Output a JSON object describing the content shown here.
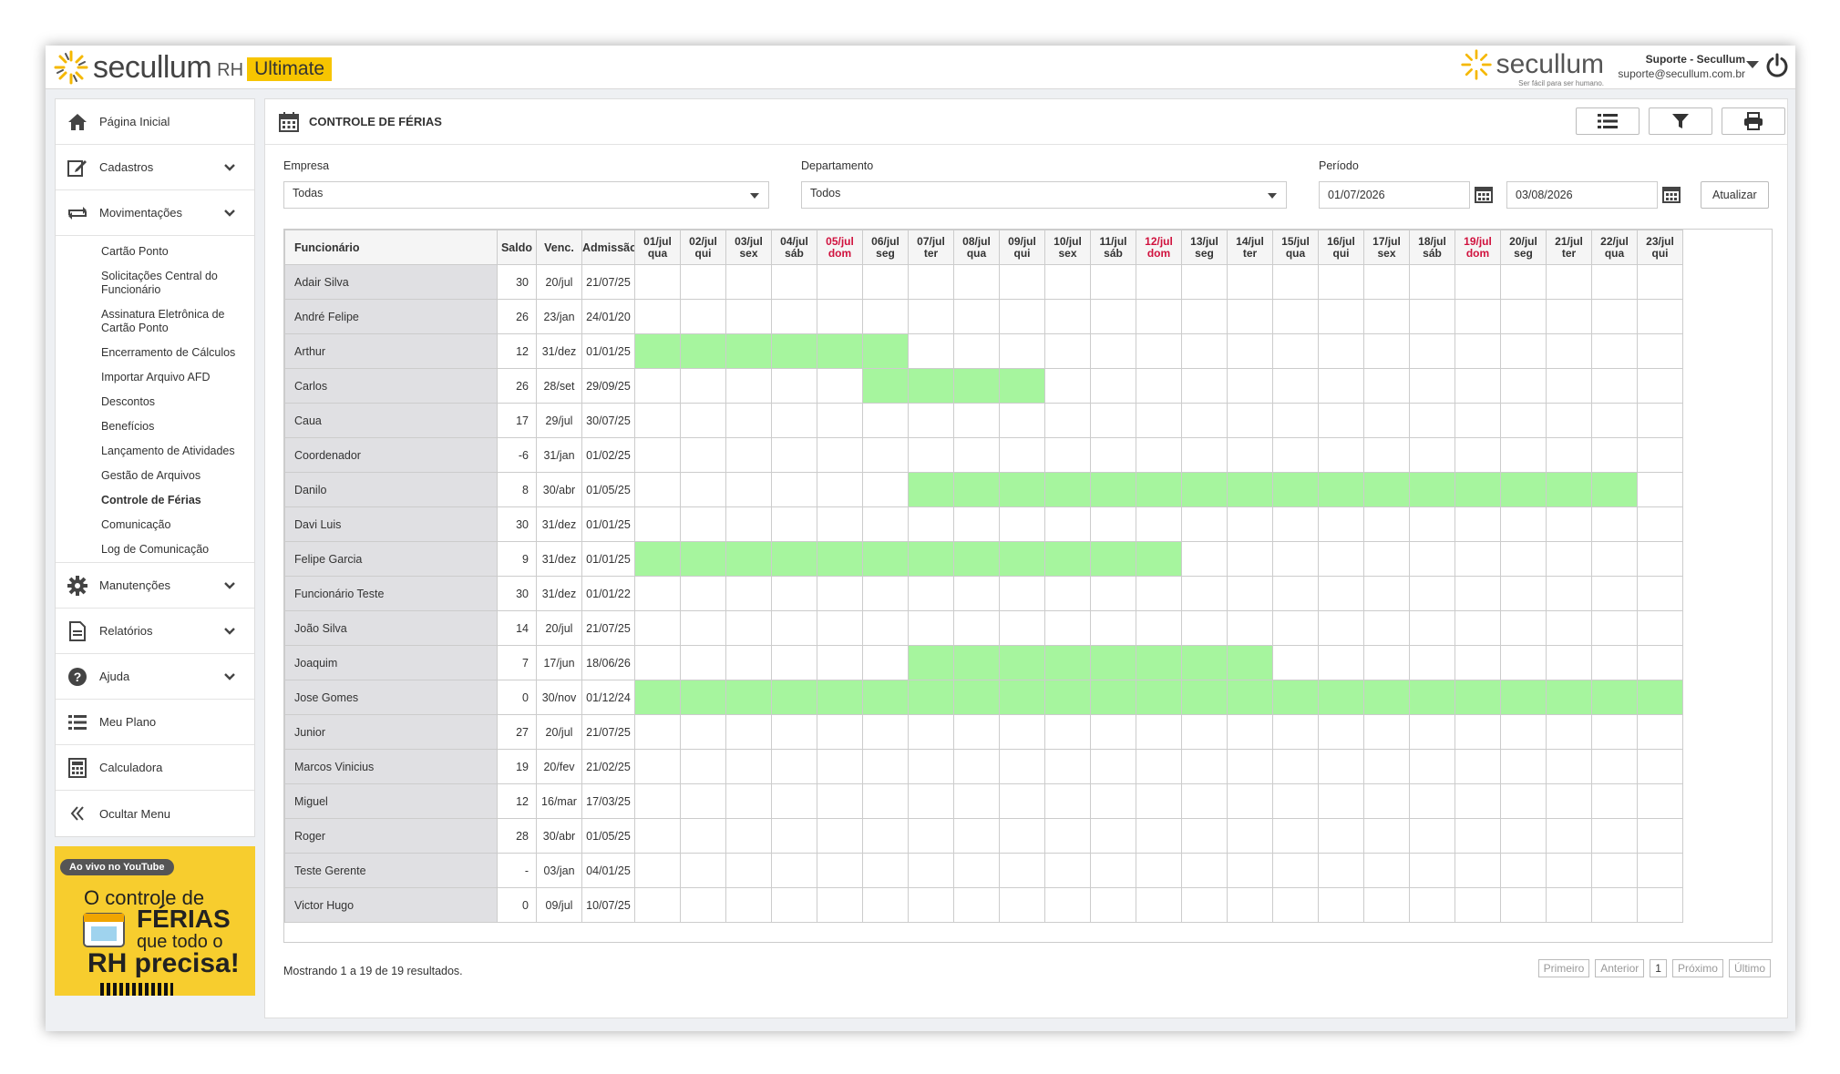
{
  "app": {
    "brand": "secullum",
    "product": "RH",
    "edition": "Ultimate",
    "top_brand": "secullum",
    "top_tagline": "Ser fácil para ser humano.",
    "user_name": "Suporte - Secullum",
    "user_email": "suporte@secullum.com.br"
  },
  "sidebar": {
    "home": "Página Inicial",
    "cadastros": "Cadastros",
    "movimentacoes": "Movimentações",
    "sub_items": [
      "Cartão Ponto",
      "Solicitações Central do Funcionário",
      "Assinatura Eletrônica de Cartão Ponto",
      "Encerramento de Cálculos",
      "Importar Arquivo AFD",
      "Descontos",
      "Benefícios",
      "Lançamento de Atividades",
      "Gestão de Arquivos",
      "Controle de Férias",
      "Comunicação",
      "Log de Comunicação"
    ],
    "active_sub": "Controle de Férias",
    "manutencoes": "Manutenções",
    "relatorios": "Relatórios",
    "ajuda": "Ajuda",
    "meu_plano": "Meu Plano",
    "calculadora": "Calculadora",
    "ocultar": "Ocultar Menu"
  },
  "promo": {
    "badge": "Ao vivo no YouTube",
    "line1": "O controle de",
    "line2": "FÉRIAS",
    "line3": "que todo o",
    "line4": "RH precisa!"
  },
  "page": {
    "title": "CONTROLE DE FÉRIAS"
  },
  "filters": {
    "empresa_label": "Empresa",
    "empresa_value": "Todas",
    "departamento_label": "Departamento",
    "departamento_value": "Todos",
    "periodo_label": "Período",
    "periodo_start": "01/07/2026",
    "periodo_end": "03/08/2026",
    "refresh_button": "Atualizar"
  },
  "table": {
    "columns": [
      "Funcionário",
      "Saldo",
      "Venc.",
      "Admissão"
    ],
    "days": [
      {
        "d": "01/jul",
        "w": "qua",
        "sun": false
      },
      {
        "d": "02/jul",
        "w": "qui",
        "sun": false
      },
      {
        "d": "03/jul",
        "w": "sex",
        "sun": false
      },
      {
        "d": "04/jul",
        "w": "sáb",
        "sun": false
      },
      {
        "d": "05/jul",
        "w": "dom",
        "sun": true
      },
      {
        "d": "06/jul",
        "w": "seg",
        "sun": false
      },
      {
        "d": "07/jul",
        "w": "ter",
        "sun": false
      },
      {
        "d": "08/jul",
        "w": "qua",
        "sun": false
      },
      {
        "d": "09/jul",
        "w": "qui",
        "sun": false
      },
      {
        "d": "10/jul",
        "w": "sex",
        "sun": false
      },
      {
        "d": "11/jul",
        "w": "sáb",
        "sun": false
      },
      {
        "d": "12/jul",
        "w": "dom",
        "sun": true
      },
      {
        "d": "13/jul",
        "w": "seg",
        "sun": false
      },
      {
        "d": "14/jul",
        "w": "ter",
        "sun": false
      },
      {
        "d": "15/jul",
        "w": "qua",
        "sun": false
      },
      {
        "d": "16/jul",
        "w": "qui",
        "sun": false
      },
      {
        "d": "17/jul",
        "w": "sex",
        "sun": false
      },
      {
        "d": "18/jul",
        "w": "sáb",
        "sun": false
      },
      {
        "d": "19/jul",
        "w": "dom",
        "sun": true
      },
      {
        "d": "20/jul",
        "w": "seg",
        "sun": false
      },
      {
        "d": "21/jul",
        "w": "ter",
        "sun": false
      },
      {
        "d": "22/jul",
        "w": "qua",
        "sun": false
      },
      {
        "d": "23/jul",
        "w": "qui",
        "sun": false
      }
    ],
    "rows": [
      {
        "name": "Adair Silva",
        "saldo": "30",
        "venc": "20/jul",
        "adm": "21/07/25",
        "vac": null
      },
      {
        "name": "André Felipe",
        "saldo": "26",
        "venc": "23/jan",
        "adm": "24/01/20",
        "vac": null
      },
      {
        "name": "Arthur",
        "saldo": "12",
        "venc": "31/dez",
        "adm": "01/01/25",
        "vac": [
          1,
          6
        ]
      },
      {
        "name": "Carlos",
        "saldo": "26",
        "venc": "28/set",
        "adm": "29/09/25",
        "vac": [
          6,
          9
        ]
      },
      {
        "name": "Caua",
        "saldo": "17",
        "venc": "29/jul",
        "adm": "30/07/25",
        "vac": null
      },
      {
        "name": "Coordenador",
        "saldo": "-6",
        "venc": "31/jan",
        "adm": "01/02/25",
        "vac": null
      },
      {
        "name": "Danilo",
        "saldo": "8",
        "venc": "30/abr",
        "adm": "01/05/25",
        "vac": [
          7,
          22
        ]
      },
      {
        "name": "Davi Luis",
        "saldo": "30",
        "venc": "31/dez",
        "adm": "01/01/25",
        "vac": null
      },
      {
        "name": "Felipe Garcia",
        "saldo": "9",
        "venc": "31/dez",
        "adm": "01/01/25",
        "vac": [
          1,
          12
        ]
      },
      {
        "name": "Funcionário Teste",
        "saldo": "30",
        "venc": "31/dez",
        "adm": "01/01/22",
        "vac": null
      },
      {
        "name": "João Silva",
        "saldo": "14",
        "venc": "20/jul",
        "adm": "21/07/25",
        "vac": null
      },
      {
        "name": "Joaquim",
        "saldo": "7",
        "venc": "17/jun",
        "adm": "18/06/26",
        "vac": [
          7,
          14
        ]
      },
      {
        "name": "Jose Gomes",
        "saldo": "0",
        "venc": "30/nov",
        "adm": "01/12/24",
        "vac": [
          1,
          23
        ]
      },
      {
        "name": "Junior",
        "saldo": "27",
        "venc": "20/jul",
        "adm": "21/07/25",
        "vac": null
      },
      {
        "name": "Marcos Vinicius",
        "saldo": "19",
        "venc": "20/fev",
        "adm": "21/02/25",
        "vac": null
      },
      {
        "name": "Miguel",
        "saldo": "12",
        "venc": "16/mar",
        "adm": "17/03/25",
        "vac": null
      },
      {
        "name": "Roger",
        "saldo": "28",
        "venc": "30/abr",
        "adm": "01/05/25",
        "vac": null
      },
      {
        "name": "Teste Gerente",
        "saldo": "-",
        "venc": "03/jan",
        "adm": "04/01/25",
        "vac": null
      },
      {
        "name": "Victor Hugo",
        "saldo": "0",
        "venc": "09/jul",
        "adm": "10/07/25",
        "vac": null
      }
    ]
  },
  "pagination": {
    "info": "Mostrando 1 a 19 de 19 resultados.",
    "first": "Primeiro",
    "prev": "Anterior",
    "current": "1",
    "next": "Próximo",
    "last": "Último"
  },
  "colors": {
    "vacation": "#a6f59e",
    "sunday": "#d0123e",
    "accent": "#f7c500"
  }
}
